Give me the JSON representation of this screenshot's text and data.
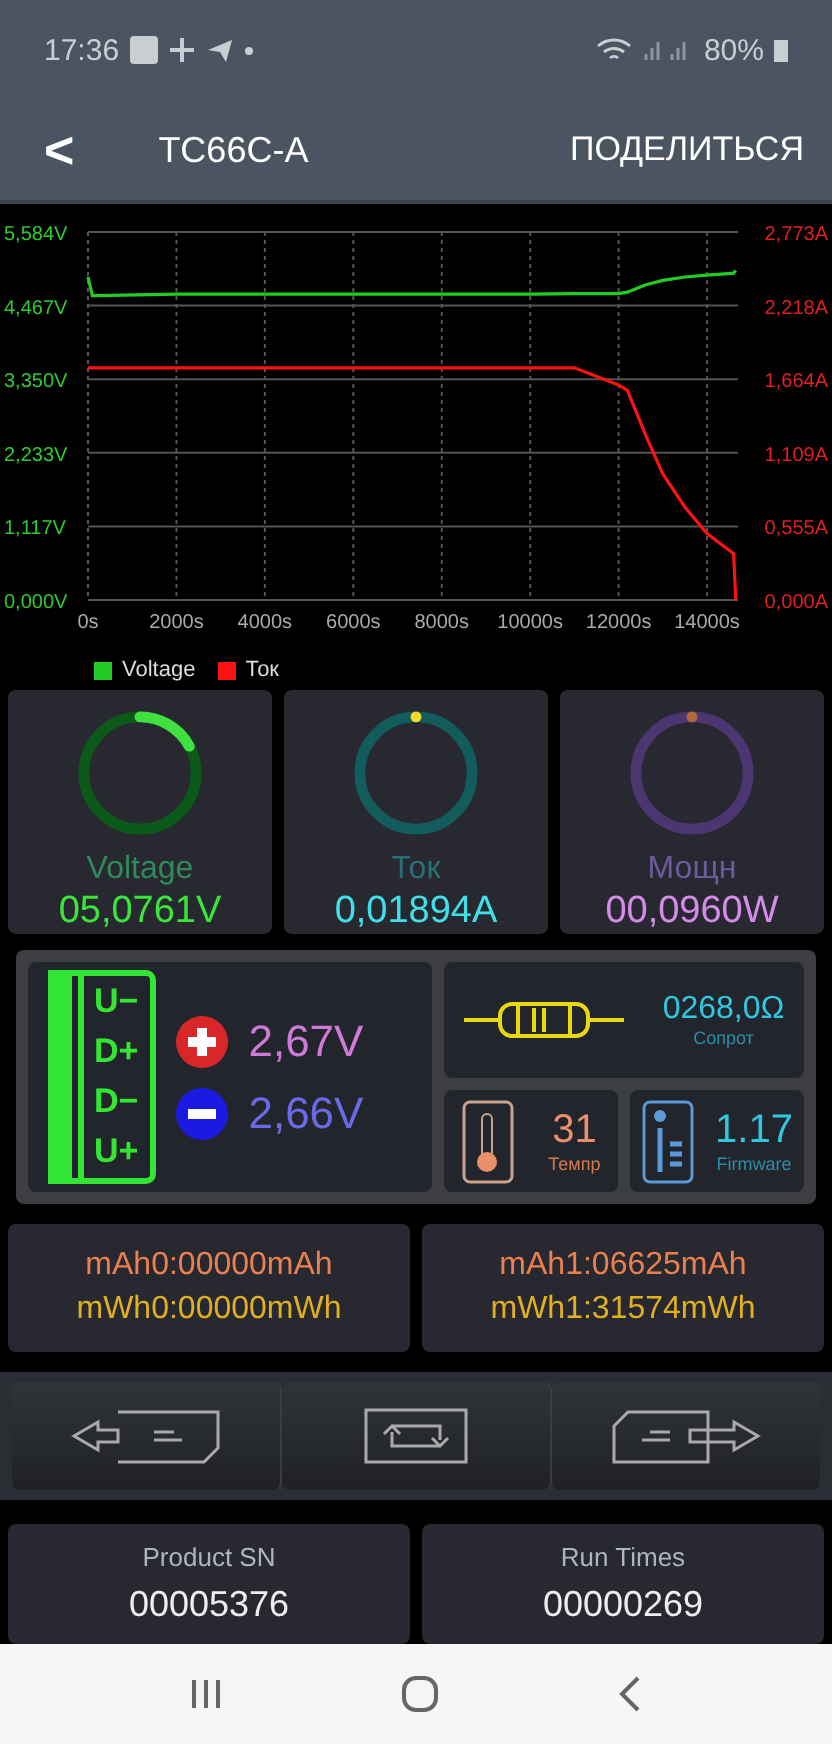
{
  "status_bar": {
    "time": "17:36",
    "battery": "80%"
  },
  "app_bar": {
    "back": "<",
    "title": "TC66C-A",
    "action": "ПОДЕЛИТЬСЯ"
  },
  "chart_data": {
    "type": "line",
    "x": [
      0,
      100,
      200,
      2000,
      4000,
      6000,
      8000,
      10000,
      11000,
      12000,
      12200,
      12600,
      13000,
      13500,
      14000,
      14400,
      14600,
      14650
    ],
    "series": [
      {
        "name": "Voltage",
        "color": "#22cc22",
        "values": [
          4.9,
          4.62,
          4.62,
          4.64,
          4.64,
          4.64,
          4.64,
          4.64,
          4.65,
          4.65,
          4.67,
          4.78,
          4.85,
          4.9,
          4.93,
          4.95,
          4.96,
          5.0
        ]
      },
      {
        "name": "Ток",
        "color": "#ff1111",
        "axis": "y2",
        "values": [
          1.75,
          1.75,
          1.75,
          1.75,
          1.75,
          1.75,
          1.75,
          1.75,
          1.75,
          1.62,
          1.58,
          1.25,
          0.95,
          0.7,
          0.5,
          0.4,
          0.35,
          0
        ]
      }
    ],
    "grid": true,
    "xlim": [
      0,
      14700
    ],
    "ylim": [
      0,
      5.584
    ],
    "y2lim": [
      0,
      2.773
    ],
    "xticks": [
      {
        "value": 0,
        "label": "0s"
      },
      {
        "value": 2000,
        "label": "2000s"
      },
      {
        "value": 4000,
        "label": "4000s"
      },
      {
        "value": 6000,
        "label": "6000s"
      },
      {
        "value": 8000,
        "label": "8000s"
      },
      {
        "value": 10000,
        "label": "10000s"
      },
      {
        "value": 12000,
        "label": "12000s"
      },
      {
        "value": 14000,
        "label": "14000s"
      }
    ],
    "yticks": [
      {
        "value": 0,
        "label": "0,000V"
      },
      {
        "value": 1.117,
        "label": "1,117V"
      },
      {
        "value": 2.233,
        "label": "2,233V"
      },
      {
        "value": 3.35,
        "label": "3,350V"
      },
      {
        "value": 4.467,
        "label": "4,467V"
      },
      {
        "value": 5.584,
        "label": "5,584V"
      }
    ],
    "y2ticks": [
      {
        "value": 0,
        "label": "0,000A"
      },
      {
        "value": 0.555,
        "label": "0,555A"
      },
      {
        "value": 1.109,
        "label": "1,109A"
      },
      {
        "value": 1.664,
        "label": "1,664A"
      },
      {
        "value": 2.218,
        "label": "2,218A"
      },
      {
        "value": 2.773,
        "label": "2,773A"
      }
    ]
  },
  "gauges": [
    {
      "label": "Voltage",
      "value": "05,0761V",
      "level": 0.17
    },
    {
      "label": "Ток",
      "value": "0,01894A",
      "level": 0
    },
    {
      "label": "Мощн",
      "value": "00,0960W",
      "level": 0
    }
  ],
  "port": {
    "pins": [
      "U−",
      "D+",
      "D−",
      "U+"
    ],
    "d_plus": "2,67V",
    "d_minus": "2,66V"
  },
  "resistance": {
    "value": "0268,0Ω",
    "label": "Сопрот"
  },
  "temperature": {
    "value": "31",
    "label": "Темпр"
  },
  "firmware": {
    "value": "1.17",
    "label": "Firmware"
  },
  "energy": [
    {
      "mah": "mAh0:00000mAh",
      "mwh": "mWh0:00000mWh"
    },
    {
      "mah": "mAh1:06625mAh",
      "mwh": "mWh1:31574mWh"
    }
  ],
  "info": [
    {
      "label": "Product SN",
      "value": "00005376"
    },
    {
      "label": "Run Times",
      "value": "00000269"
    }
  ]
}
